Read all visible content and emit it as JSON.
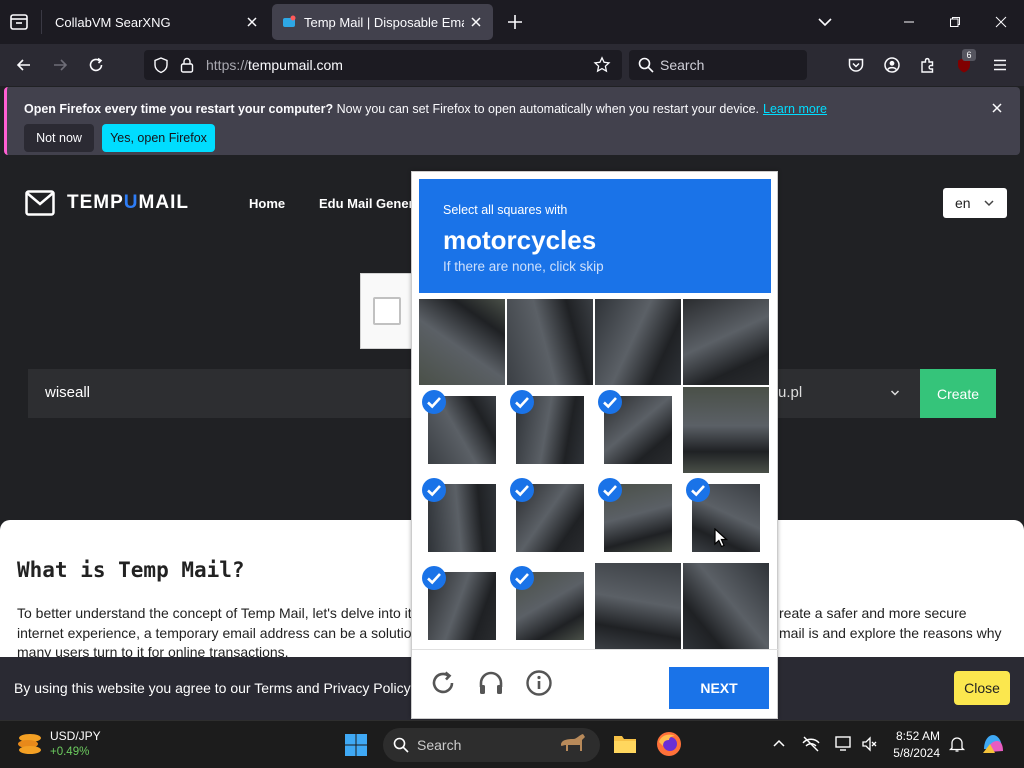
{
  "browser": {
    "tabs": [
      {
        "title": "CollabVM SearXNG",
        "active": false
      },
      {
        "title": "Temp Mail | Disposable Email A",
        "active": true
      }
    ],
    "url_scheme": "https://",
    "url_host": "tempumail.com",
    "search_placeholder": "Search",
    "extension_badge": "6"
  },
  "notification": {
    "bold": "Open Firefox every time you restart your computer?",
    "text": " Now you can set Firefox to open automatically when you restart your device.",
    "link": "Learn more",
    "not_now": "Not now",
    "yes": "Yes, open Firefox"
  },
  "site": {
    "logo_pre": "TEMP",
    "logo_u": "U",
    "logo_post": "MAIL",
    "nav": [
      "Home",
      "Edu Mail Genera"
    ],
    "lang": "en",
    "email_value": "wiseall",
    "domain_value": "u.pl",
    "create_label": "Create",
    "article_title": "What is Temp Mail?",
    "para_left": [
      "To better understand the concept of Temp Mail, let's delve into it",
      "internet experience, a temporary email address can be a solutio",
      "many users turn to it for online transactions."
    ],
    "para_right": [
      "reate a safer and more secure",
      "mail is and explore the reasons why"
    ],
    "cookie_text": "By using this website you agree to our Terms and Privacy Policy",
    "cookie_close": "Close"
  },
  "captcha": {
    "instruction": "Select all squares with",
    "target": "motorcycles",
    "subtext": "If there are none, click skip",
    "selected": [
      [
        false,
        false,
        false,
        false
      ],
      [
        true,
        true,
        true,
        false
      ],
      [
        true,
        true,
        true,
        true
      ],
      [
        true,
        true,
        false,
        false
      ]
    ],
    "next_label": "NEXT"
  },
  "taskbar": {
    "widget_pair": "USD/JPY",
    "widget_change": "+0.49%",
    "search_placeholder": "Search",
    "time": "8:52 AM",
    "date": "5/8/2024"
  },
  "colors": {
    "captcha_blue": "#1a73e8",
    "create_green": "#35c47a",
    "firefox_cyan": "#00ddff",
    "cookie_yellow": "#fbe74e"
  }
}
